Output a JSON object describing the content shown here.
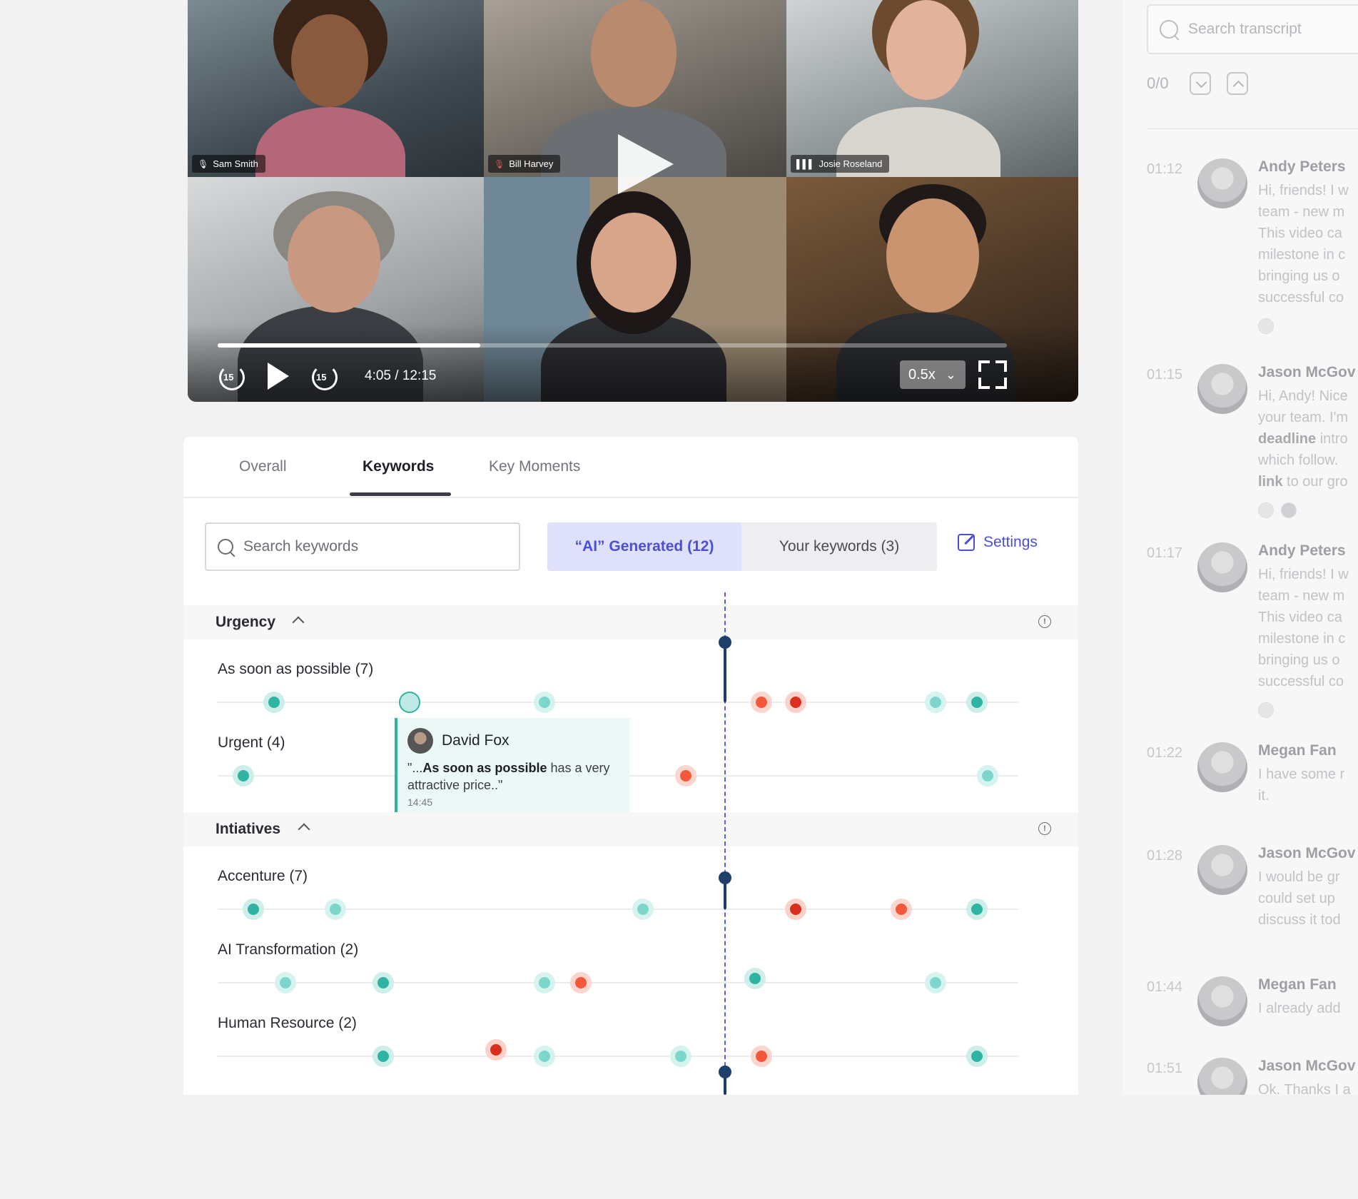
{
  "video": {
    "participants": [
      "Sam Smith",
      "Bill Harvey",
      "Josie Roseland"
    ],
    "time": "4:05 / 12:15",
    "progress": 0.333,
    "skip_back": "15",
    "skip_forward": "15",
    "speed": "0.5x",
    "speed_arrow": "⌄"
  },
  "tabs": [
    "Overall",
    "Keywords",
    "Key Moments"
  ],
  "active_tab": "Keywords",
  "keyword_search": {
    "placeholder": "Search keywords"
  },
  "segmented": {
    "ai": "“AI” Generated (12)",
    "yours": "Your keywords (3)"
  },
  "settings_label": "Settings",
  "groups": [
    {
      "name": "Urgency"
    },
    {
      "name": "Intiatives"
    }
  ],
  "keywords": {
    "k0": "As soon as possible (7)",
    "k1": "Urgent (4)",
    "k2": "Accenture (7)",
    "k3": "AI Transformation (2)",
    "k4": "Human Resource (2)"
  },
  "tooltip": {
    "name": "David Fox",
    "quote_open": "\"...",
    "quote_bold": "As soon as possible",
    "quote_rest": " has a very attractive price..\"",
    "time": "14:45"
  },
  "transcript": {
    "search_placeholder": "Search transcript",
    "count": "0/0",
    "entries": [
      {
        "time": "01:12",
        "name": "Andy Peters",
        "text": "Hi, friends! I w\nteam - new m\nThis video ca\nmilestone in c\nbringing us o\nsuccessful co"
      },
      {
        "time": "01:15",
        "name": "Jason McGov",
        "text_a": "Hi, Andy! Nice\nyour team. I'm\n",
        "bold1": "deadline",
        "text_b": " intro\nwhich follow.\n",
        "bold2": "link",
        "text_c": " to our gro"
      },
      {
        "time": "01:17",
        "name": "Andy Peters",
        "text": "Hi, friends! I w\nteam - new m\nThis video ca\nmilestone in c\nbringing us o\nsuccessful co"
      },
      {
        "time": "01:22",
        "name": "Megan Fan",
        "text": "I have some r\nit."
      },
      {
        "time": "01:28",
        "name": "Jason McGov",
        "text": "I would be gr\ncould set up\ndiscuss it tod"
      },
      {
        "time": "01:44",
        "name": "Megan Fan",
        "text": "I already add"
      },
      {
        "time": "01:51",
        "name": "Jason McGov",
        "text": "Ok. Thanks I a"
      }
    ]
  },
  "colors": {
    "accent": "#4b4fd6",
    "teal": "#2fb3a3",
    "red": "#d9301d",
    "playhead": "#1f3f6b"
  },
  "icons": [
    "mic-icon",
    "mic-muted-icon",
    "audio-wave-icon",
    "play-icon",
    "rewind-15-icon",
    "forward-15-icon",
    "fullscreen-icon",
    "search-icon",
    "edit-icon",
    "chevron-up-icon",
    "info-icon"
  ]
}
